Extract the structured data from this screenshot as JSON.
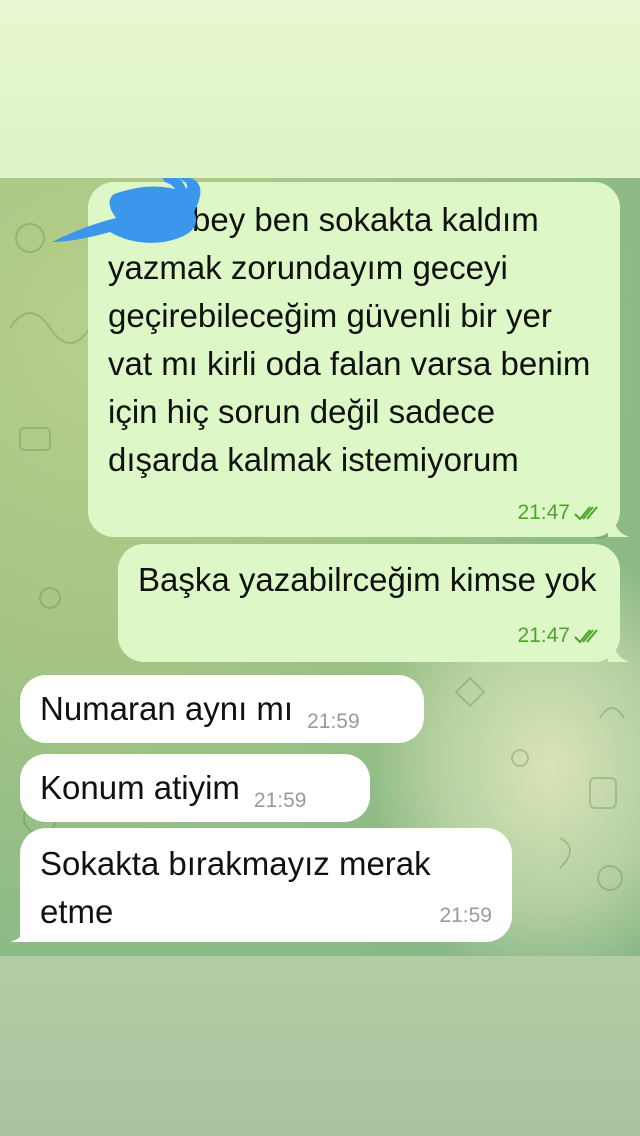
{
  "messages": [
    {
      "direction": "outgoing",
      "text_line1": "bey ben sokakta kaldım",
      "text_rest": "yazmak zorundayım geceyi geçirebileceğim güvenli bir yer vat mı kirli oda falan varsa benim için hiç sorun değil sadece dışarda kalmak istemiyorum",
      "time": "21:47",
      "status": "read",
      "status_icon": "double-check-icon",
      "name_redacted": true
    },
    {
      "direction": "outgoing",
      "text": "Başka yazabilrceğim kimse yok",
      "time": "21:47",
      "status": "read",
      "status_icon": "double-check-icon"
    },
    {
      "direction": "incoming",
      "text": "Numaran aynı mı",
      "time": "21:59"
    },
    {
      "direction": "incoming",
      "text": "Konum atiyim",
      "time": "21:59"
    },
    {
      "direction": "incoming",
      "text": "Sokakta bırakmayız merak etme",
      "time": "21:59"
    }
  ],
  "colors": {
    "outgoing_bubble": "#ddf8c6",
    "incoming_bubble": "#ffffff",
    "outgoing_time": "#4da32b",
    "incoming_time": "#9a9a9a",
    "redaction_marker": "#3b96ec"
  }
}
